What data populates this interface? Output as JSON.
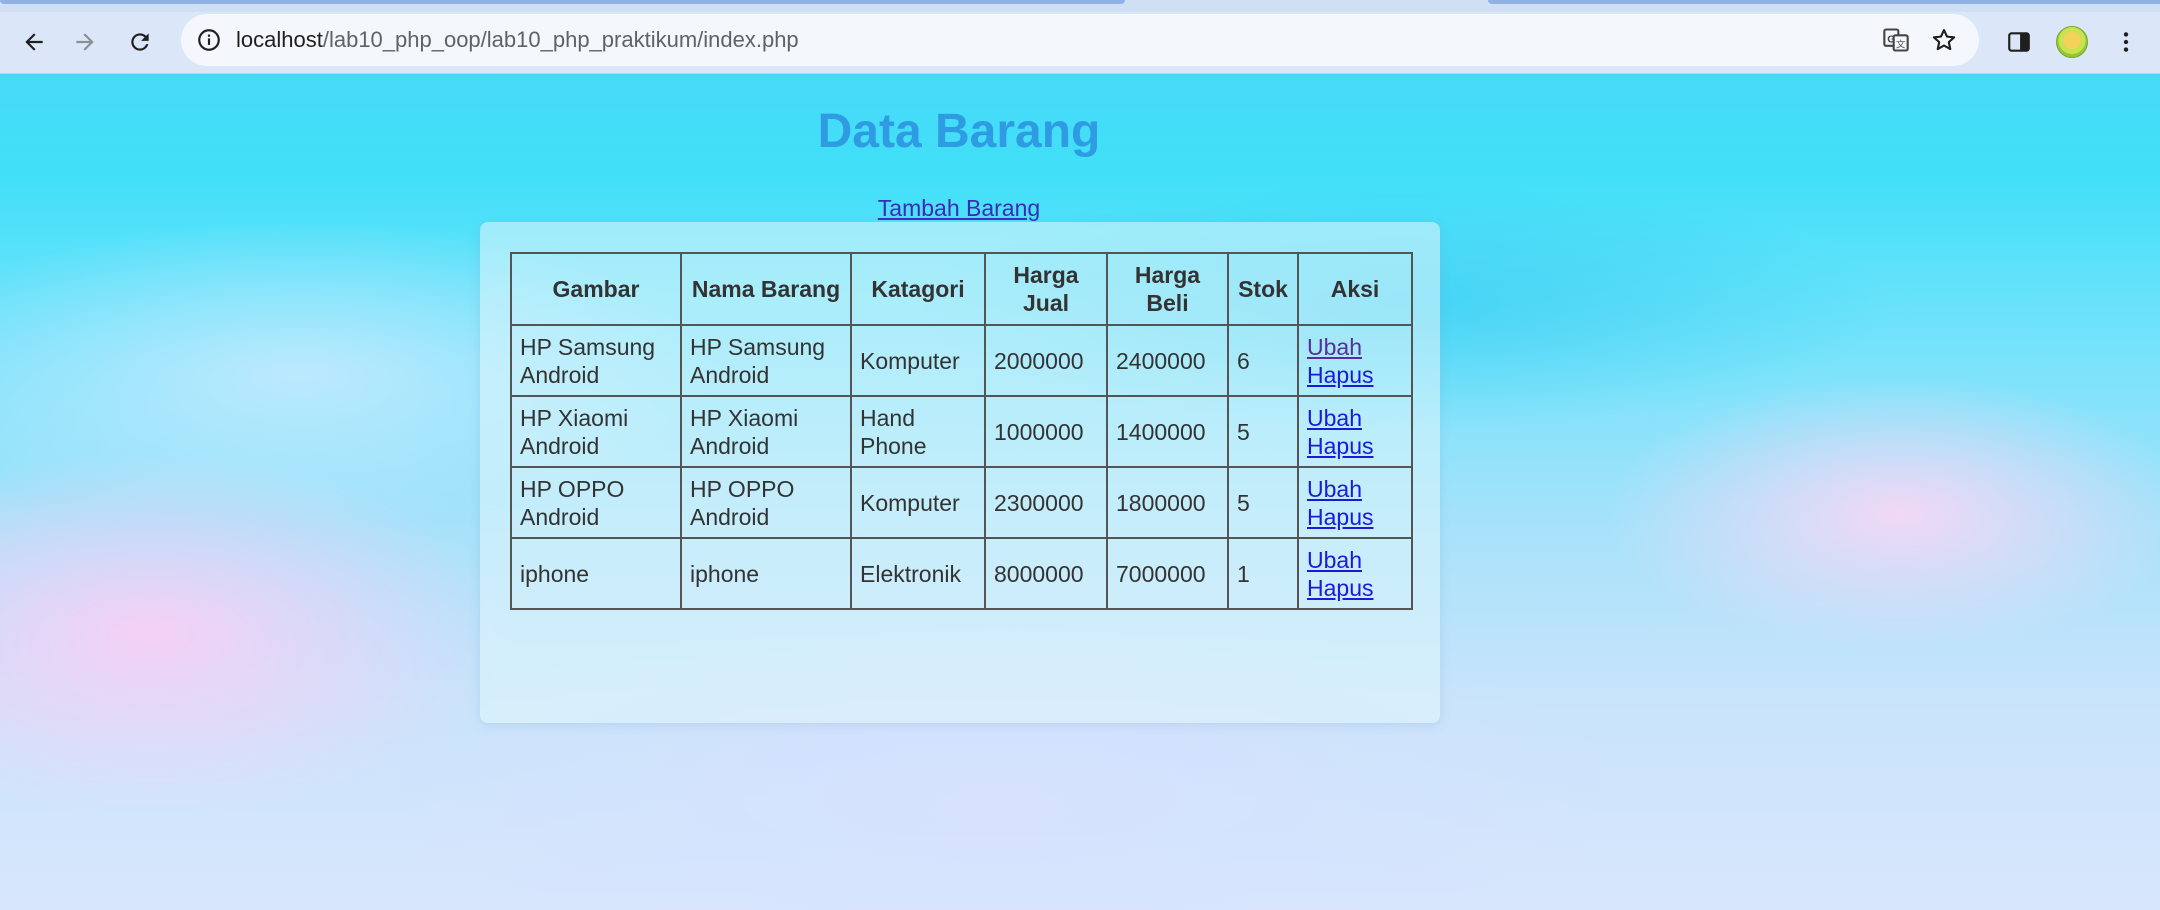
{
  "browser": {
    "url_host": "localhost",
    "url_path": "/lab10_php_oop/lab10_php_praktikum/index.php",
    "icons": {
      "back": "back-arrow-icon",
      "forward": "forward-arrow-icon",
      "reload": "reload-icon",
      "site_info": "info-icon",
      "translate": "translate-icon",
      "bookmark": "star-icon",
      "side_panel": "side-panel-icon",
      "profile": "profile-avatar",
      "menu": "kebab-menu-icon"
    }
  },
  "page": {
    "title": "Data Barang",
    "add_link": "Tambah Barang"
  },
  "table": {
    "headers": [
      "Gambar",
      "Nama Barang",
      "Katagori",
      "Harga Jual",
      "Harga Beli",
      "Stok",
      "Aksi"
    ],
    "rows": [
      {
        "gambar": "HP Samsung Android",
        "nama": "HP Samsung Android",
        "kategori": "Komputer",
        "harga_jual": "2000000",
        "harga_beli": "2400000",
        "stok": "6",
        "ubah": "Ubah",
        "hapus": "Hapus"
      },
      {
        "gambar": "HP Xiaomi Android",
        "nama": "HP Xiaomi Android",
        "kategori": "Hand Phone",
        "harga_jual": "1000000",
        "harga_beli": "1400000",
        "stok": "5",
        "ubah": "Ubah",
        "hapus": "Hapus"
      },
      {
        "gambar": "HP OPPO Android",
        "nama": "HP OPPO Android",
        "kategori": "Komputer",
        "harga_jual": "2300000",
        "harga_beli": "1800000",
        "stok": "5",
        "ubah": "Ubah",
        "hapus": "Hapus"
      },
      {
        "gambar": "iphone",
        "nama": "iphone",
        "kategori": "Elektronik",
        "harga_jual": "8000000",
        "harga_beli": "7000000",
        "stok": "1",
        "ubah": "Ubah",
        "hapus": "Hapus"
      }
    ]
  },
  "colors": {
    "title": "#2f9be3",
    "link": "#1a1ad8",
    "visited_link": "#5a2c9c"
  }
}
